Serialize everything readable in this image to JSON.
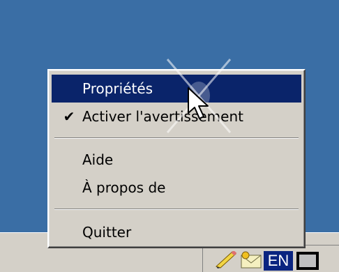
{
  "context_menu": {
    "items": [
      {
        "label": "Propriétés",
        "checked": false,
        "selected": true
      },
      {
        "label": "Activer l'avertissement",
        "checked": true,
        "selected": false
      },
      {
        "label": "Aide",
        "checked": false,
        "selected": false
      },
      {
        "label": "À propos de",
        "checked": false,
        "selected": false
      },
      {
        "label": "Quitter",
        "checked": false,
        "selected": false
      }
    ],
    "check_glyph": "✔"
  },
  "tray": {
    "language": "EN",
    "icons": [
      "pencil-icon",
      "envelope-icon",
      "monitor-icon"
    ]
  },
  "colors": {
    "desktop": "#3a6ea5",
    "menu_bg": "#d4d0c8",
    "highlight": "#0a246a",
    "lang_bg": "#0a2480"
  }
}
